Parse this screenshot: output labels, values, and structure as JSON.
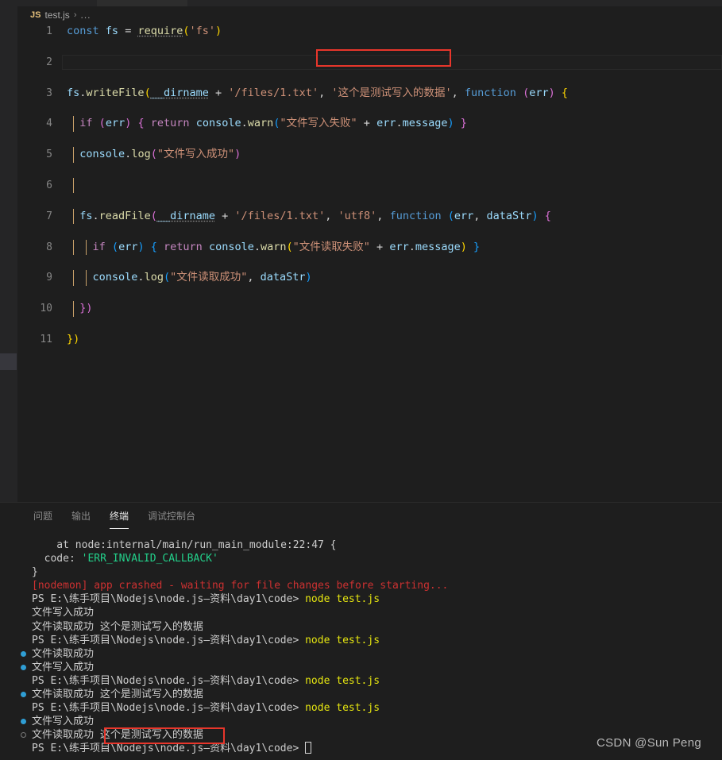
{
  "window": {
    "theme_bg": "#1e1e1e",
    "accent_red": "#e8362b"
  },
  "breadcrumb": {
    "file_icon_label": "JS",
    "file_name": "test.js",
    "separator": "›",
    "more": "..."
  },
  "editor": {
    "language": "javascript",
    "active_line": 2,
    "lines": [
      {
        "n": "1",
        "text": "const fs = require('fs')"
      },
      {
        "n": "2",
        "text": ""
      },
      {
        "n": "3",
        "text": "fs.writeFile(__dirname + '/files/1.txt', '这个是测试写入的数据', function (err) {"
      },
      {
        "n": "4",
        "text": "  if (err) { return console.warn(\"文件写入失败\" + err.message) }"
      },
      {
        "n": "5",
        "text": "  console.log(\"文件写入成功\")"
      },
      {
        "n": "6",
        "text": ""
      },
      {
        "n": "7",
        "text": "  fs.readFile(__dirname + '/files/1.txt', 'utf8', function (err, dataStr) {"
      },
      {
        "n": "8",
        "text": "    if (err) { return console.warn(\"文件读取失败\" + err.message) }"
      },
      {
        "n": "9",
        "text": "    console.log(\"文件读取成功\", dataStr)"
      },
      {
        "n": "10",
        "text": "  })"
      },
      {
        "n": "11",
        "text": "})"
      }
    ],
    "highlight_note": "这个是测试写入的数据"
  },
  "panel": {
    "tabs": [
      {
        "label": "问题",
        "active": false
      },
      {
        "label": "输出",
        "active": false
      },
      {
        "label": "终端",
        "active": true
      },
      {
        "label": "调试控制台",
        "active": false
      }
    ]
  },
  "terminal": {
    "prompt_path": "PS E:\\练手项目\\Nodejs\\node.js—资料\\day1\\code>",
    "command": "node test.js",
    "lines": [
      {
        "deco": "none",
        "segments": [
          {
            "text": "    at node:internal/main/run_main_module:22:47 {",
            "color": "c-white"
          }
        ]
      },
      {
        "deco": "none",
        "segments": [
          {
            "text": "  code: ",
            "color": "c-white"
          },
          {
            "text": "'ERR_INVALID_CALLBACK'",
            "color": "c-green"
          }
        ]
      },
      {
        "deco": "none",
        "segments": [
          {
            "text": "}",
            "color": "c-white"
          }
        ]
      },
      {
        "deco": "none",
        "segments": [
          {
            "text": "[nodemon] app crashed - waiting for file changes before starting...",
            "color": "c-red"
          }
        ]
      },
      {
        "deco": "none",
        "segments": [
          {
            "text": "PS E:\\练手项目\\Nodejs\\node.js—资料\\day1\\code> ",
            "color": "c-white"
          },
          {
            "text": "node test.js",
            "color": "c-yellow"
          }
        ]
      },
      {
        "deco": "none",
        "segments": [
          {
            "text": "文件写入成功",
            "color": "c-white"
          }
        ]
      },
      {
        "deco": "none",
        "segments": [
          {
            "text": "文件读取成功 这个是测试写入的数据",
            "color": "c-white"
          }
        ]
      },
      {
        "deco": "none",
        "segments": [
          {
            "text": "PS E:\\练手项目\\Nodejs\\node.js—资料\\day1\\code> ",
            "color": "c-white"
          },
          {
            "text": "node test.js",
            "color": "c-yellow"
          }
        ]
      },
      {
        "deco": "ok",
        "segments": [
          {
            "text": "文件读取成功",
            "color": "c-white"
          }
        ]
      },
      {
        "deco": "ok",
        "segments": [
          {
            "text": "文件写入成功",
            "color": "c-white"
          }
        ]
      },
      {
        "deco": "none",
        "segments": [
          {
            "text": "PS E:\\练手项目\\Nodejs\\node.js—资料\\day1\\code> ",
            "color": "c-white"
          },
          {
            "text": "node test.js",
            "color": "c-yellow"
          }
        ]
      },
      {
        "deco": "ok",
        "segments": [
          {
            "text": "文件读取成功 这个是测试写入的数据",
            "color": "c-white"
          }
        ]
      },
      {
        "deco": "none",
        "segments": [
          {
            "text": "PS E:\\练手项目\\Nodejs\\node.js—资料\\day1\\code> ",
            "color": "c-white"
          },
          {
            "text": "node test.js",
            "color": "c-yellow"
          }
        ]
      },
      {
        "deco": "ok",
        "segments": [
          {
            "text": "文件写入成功",
            "color": "c-white"
          }
        ]
      },
      {
        "deco": "pending",
        "segments": [
          {
            "text": "文件读取成功 这个是测试写入的数据",
            "color": "c-white"
          }
        ]
      },
      {
        "deco": "none",
        "cursor": true,
        "segments": [
          {
            "text": "PS E:\\练手项目\\Nodejs\\node.js—资料\\day1\\code> ",
            "color": "c-white"
          }
        ]
      }
    ]
  },
  "watermark": {
    "text": "CSDN @Sun  Peng"
  }
}
